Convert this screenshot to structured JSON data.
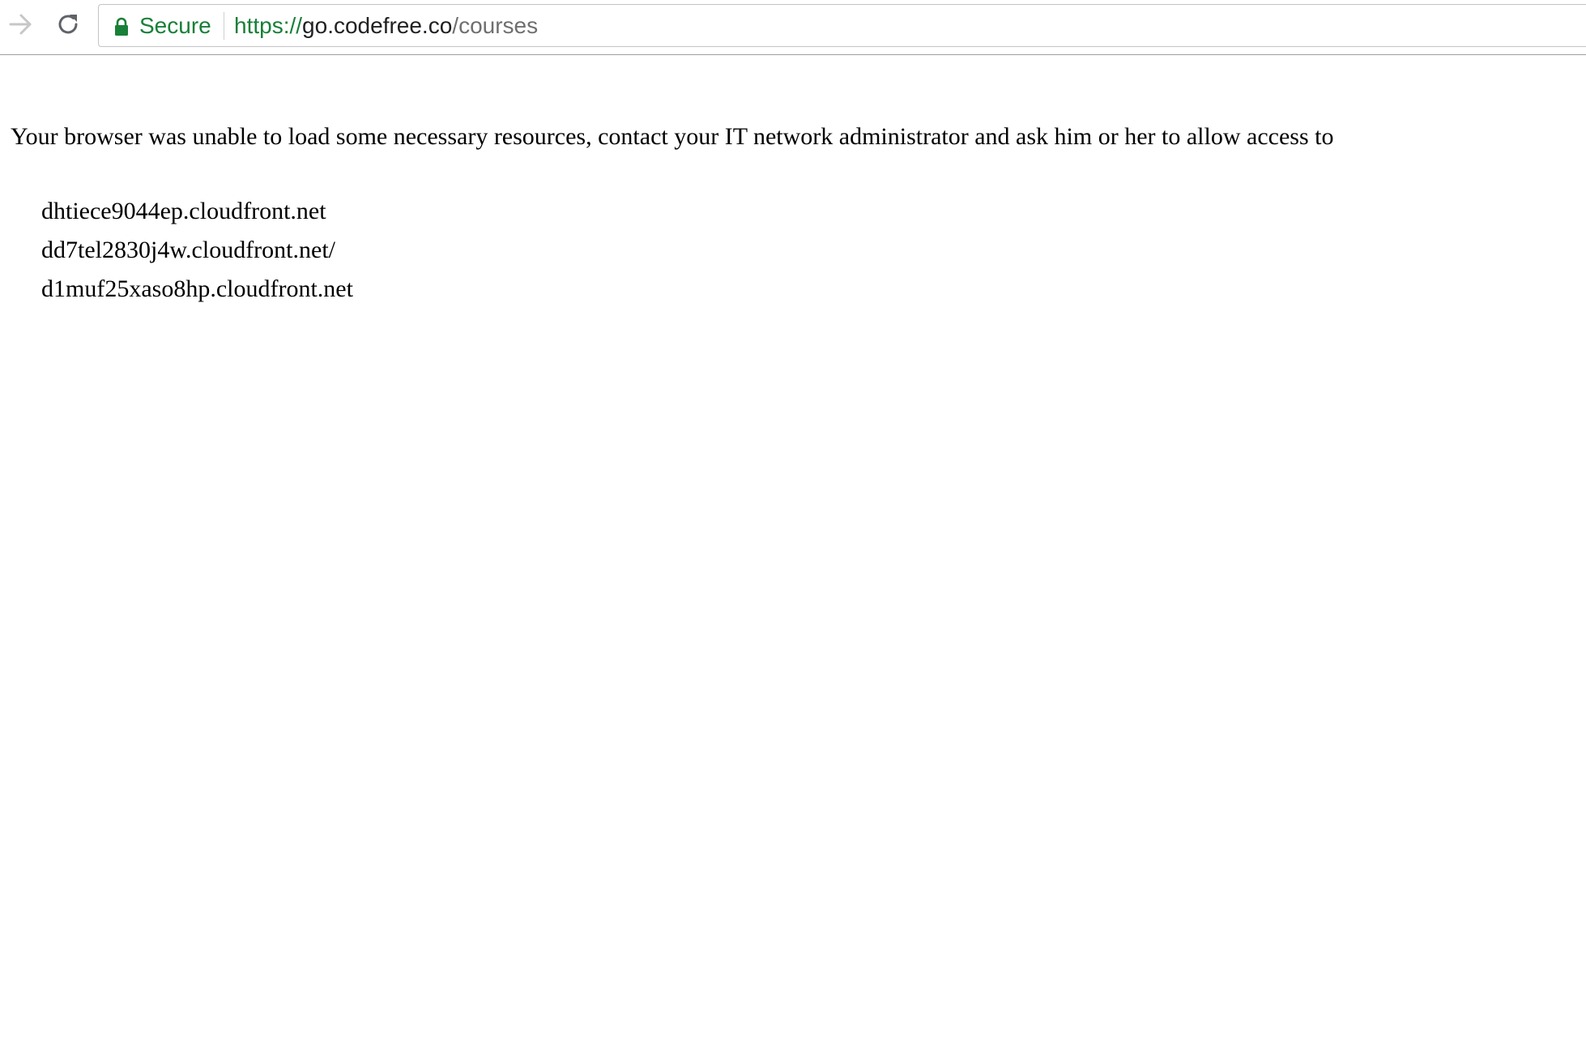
{
  "browser": {
    "security_label": "Secure",
    "url": {
      "scheme": "https://",
      "host": "go.codefree.co",
      "path": "/courses"
    },
    "icons": {
      "forward": "arrow-right-icon",
      "reload": "reload-icon",
      "lock": "lock-icon"
    },
    "colors": {
      "secure_green": "#188038",
      "path_gray": "#6f6f6f"
    }
  },
  "page": {
    "message": "Your browser was unable to load some necessary resources, contact your IT network administrator and ask him or her to allow access to",
    "domains": [
      "dhtiece9044ep.cloudfront.net",
      "dd7tel2830j4w.cloudfront.net/",
      "d1muf25xaso8hp.cloudfront.net"
    ]
  }
}
